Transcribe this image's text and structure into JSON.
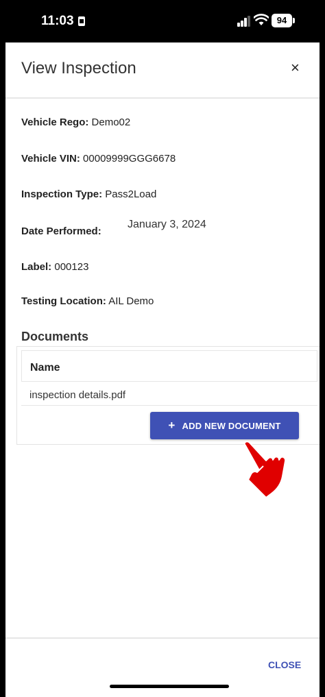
{
  "status_bar": {
    "time": "11:03",
    "battery": "94"
  },
  "dialog": {
    "title": "View Inspection",
    "close_icon": "×"
  },
  "fields": {
    "rego_label": "Vehicle Rego:",
    "rego_value": "Demo02",
    "vin_label": "Vehicle VIN:",
    "vin_value": "00009999GGG6678",
    "type_label": "Inspection Type:",
    "type_value": "Pass2Load",
    "date_label": "Date Performed:",
    "date_value": "January 3, 2024",
    "label_label": "Label:",
    "label_value": "000123",
    "location_label": "Testing Location:",
    "location_value": "AIL Demo"
  },
  "documents": {
    "heading": "Documents",
    "column_name": "Name",
    "rows": [
      "inspection details.pdf"
    ],
    "add_button_icon": "+",
    "add_button_label": "ADD NEW DOCUMENT"
  },
  "footer": {
    "close_label": "CLOSE"
  },
  "colors": {
    "primary": "#3f51b5",
    "pointer_hand": "#e00000"
  }
}
